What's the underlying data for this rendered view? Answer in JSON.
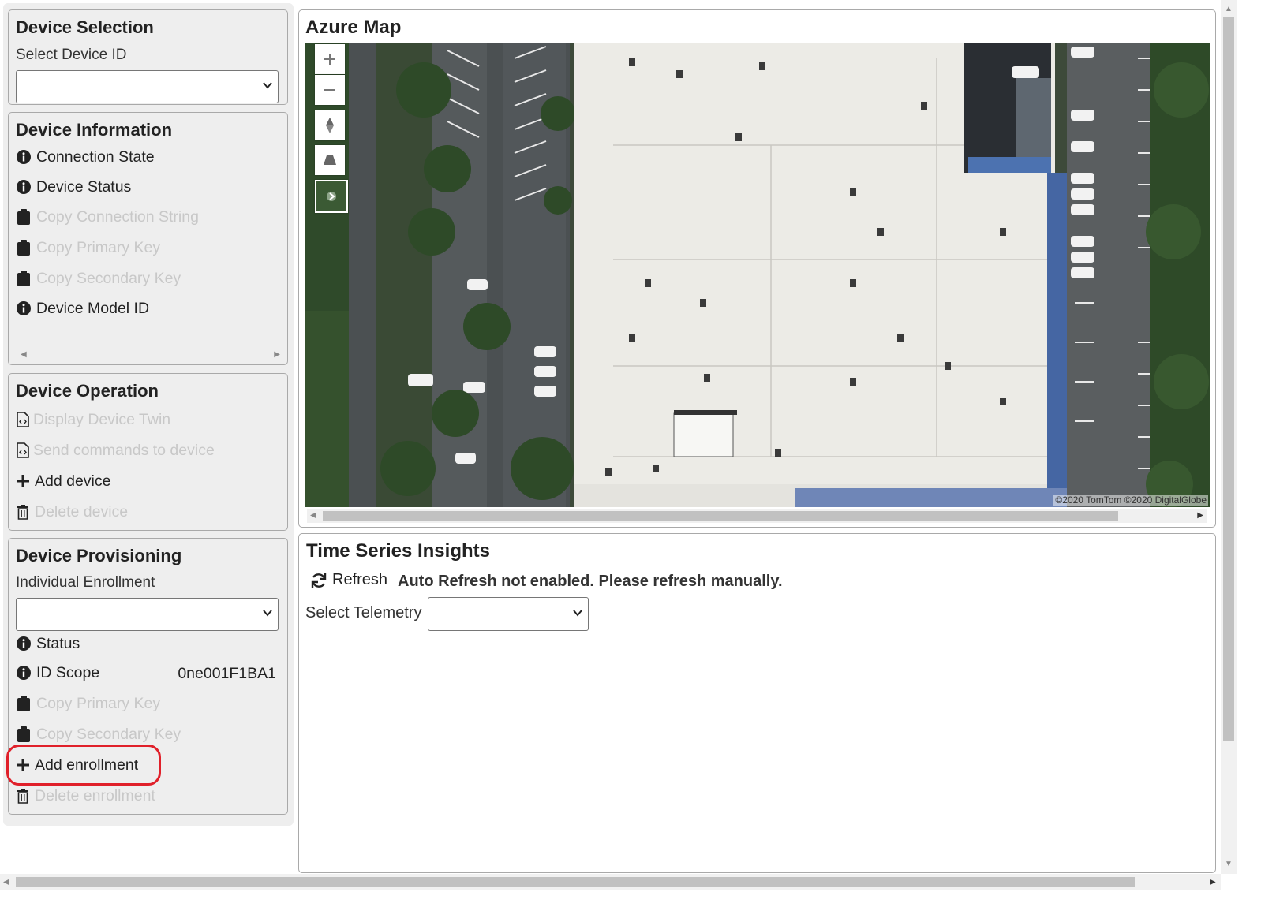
{
  "sidebar": {
    "device_selection": {
      "title": "Device Selection",
      "label": "Select Device ID",
      "selected": ""
    },
    "device_information": {
      "title": "Device Information",
      "items": [
        {
          "label": "Connection State",
          "icon": "info-icon",
          "enabled": true
        },
        {
          "label": "Device Status",
          "icon": "info-icon",
          "enabled": true
        },
        {
          "label": "Copy Connection String",
          "icon": "clipboard-icon",
          "enabled": false
        },
        {
          "label": "Copy Primary Key",
          "icon": "clipboard-icon",
          "enabled": false
        },
        {
          "label": "Copy Secondary Key",
          "icon": "clipboard-icon",
          "enabled": false
        },
        {
          "label": "Device Model ID",
          "icon": "info-icon",
          "enabled": true
        }
      ]
    },
    "device_operation": {
      "title": "Device Operation",
      "items": [
        {
          "label": "Display Device Twin",
          "icon": "code-file-icon",
          "enabled": false
        },
        {
          "label": "Send commands to device",
          "icon": "code-file-icon",
          "enabled": false
        },
        {
          "label": "Add device",
          "icon": "plus-icon",
          "enabled": true
        },
        {
          "label": "Delete device",
          "icon": "trash-icon",
          "enabled": false
        }
      ]
    },
    "device_provisioning": {
      "title": "Device Provisioning",
      "label": "Individual Enrollment",
      "selected": "",
      "items": [
        {
          "label": "Status",
          "icon": "info-icon",
          "enabled": true,
          "value": ""
        },
        {
          "label": "ID Scope",
          "icon": "info-icon",
          "enabled": true,
          "value": "0ne001F1BA1"
        },
        {
          "label": "Copy Primary Key",
          "icon": "clipboard-icon",
          "enabled": false
        },
        {
          "label": "Copy Secondary Key",
          "icon": "clipboard-icon",
          "enabled": false
        },
        {
          "label": "Add enrollment",
          "icon": "plus-icon",
          "enabled": true
        },
        {
          "label": "Delete enrollment",
          "icon": "trash-icon",
          "enabled": false
        }
      ]
    }
  },
  "map": {
    "title": "Azure Map",
    "attribution": "©2020 TomTom ©2020 DigitalGlobe"
  },
  "tsi": {
    "title": "Time Series Insights",
    "refresh_label": "Refresh",
    "refresh_note": "Auto Refresh not enabled. Please refresh manually.",
    "telemetry_label": "Select Telemetry",
    "telemetry_selected": ""
  },
  "colors": {
    "highlight": "#e0202a",
    "panel_bg": "#eeeeee",
    "disabled_text": "#c8c8c8"
  }
}
